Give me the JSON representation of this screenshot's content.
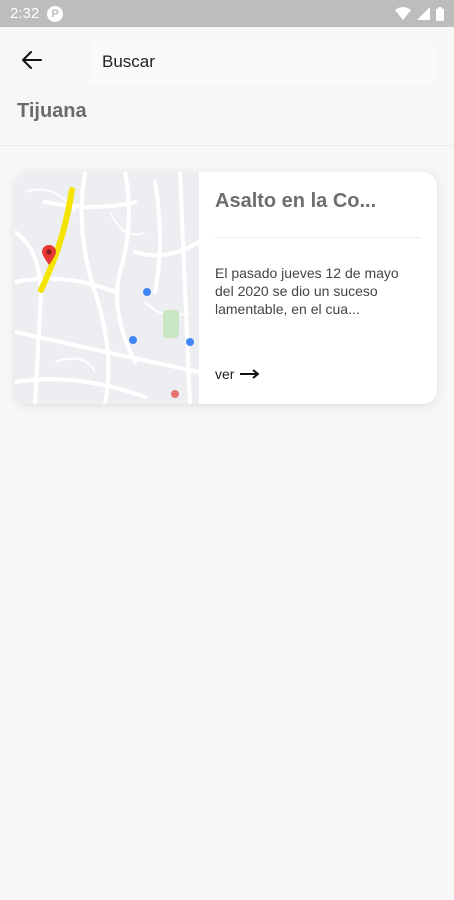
{
  "status_bar": {
    "time": "2:32",
    "notification_glyph": "P",
    "icons": [
      "wifi-icon",
      "signal-icon",
      "battery-icon"
    ]
  },
  "search": {
    "placeholder": "Buscar",
    "back_icon": "arrow-left-icon"
  },
  "city": "Tijuana",
  "cards": [
    {
      "title": "Asalto en la Co...",
      "description": "El pasado jueves 12 de mayo del 2020 se dio un suceso lamentable, en el cua...",
      "link_label": "ver",
      "link_icon": "arrow-right-icon",
      "map_icon": "map-pin-icon"
    }
  ],
  "colors": {
    "background": "#f7f7f8",
    "status_bar": "#bdbdbd",
    "card": "#ffffff",
    "title_gray": "#6e6e6e",
    "route_yellow": "#f5e400",
    "pin_red": "#e53935"
  }
}
